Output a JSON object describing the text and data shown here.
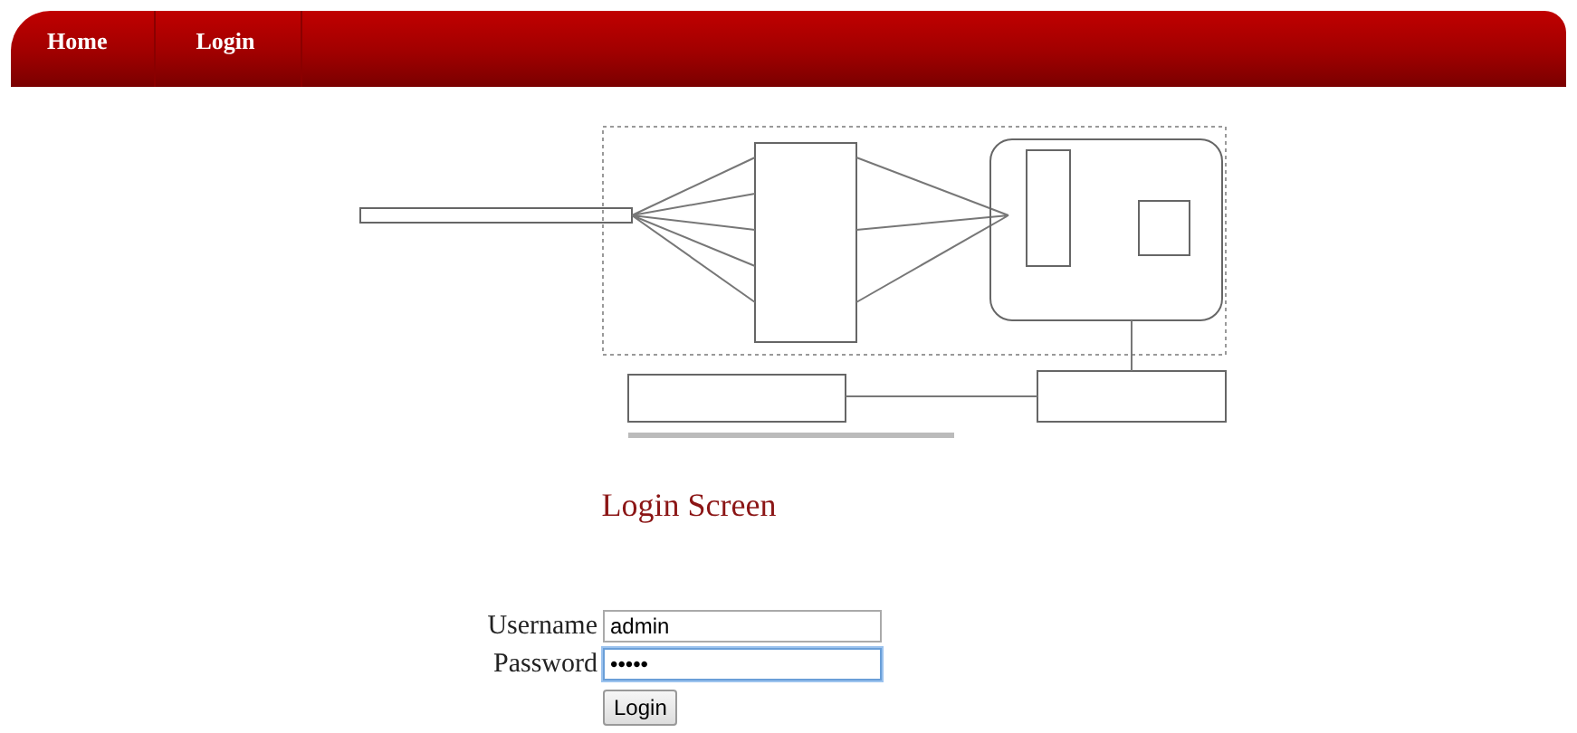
{
  "nav": [
    {
      "label": "Home"
    },
    {
      "label": "Login"
    }
  ],
  "heading": "Login Screen",
  "form": {
    "fields": [
      {
        "label": "Username",
        "value": "admin",
        "focused": false
      },
      {
        "label": "Password",
        "value": "•••••",
        "focused": true
      }
    ],
    "submit": "Login"
  }
}
